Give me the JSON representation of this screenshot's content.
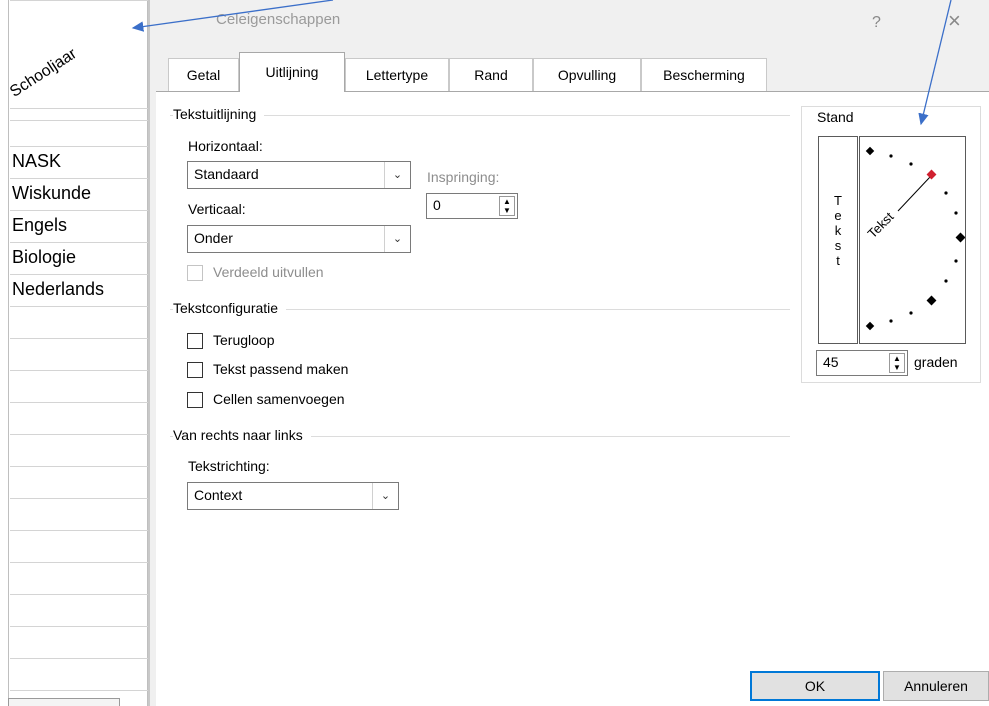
{
  "sheet": {
    "header": "Schooljaar",
    "rows": [
      "NASK",
      "Wiskunde",
      "Engels",
      "Biologie",
      "Nederlands"
    ]
  },
  "dialog": {
    "title": "Celeigenschappen",
    "help": "?",
    "close": "×",
    "tabs": [
      "Getal",
      "Uitlijning",
      "Lettertype",
      "Rand",
      "Opvulling",
      "Bescherming"
    ],
    "active_tab": "Uitlijning",
    "text_alignment": {
      "group": "Tekstuitlijning",
      "horizontal_label": "Horizontaal:",
      "horizontal_value": "Standaard",
      "vertical_label": "Verticaal:",
      "vertical_value": "Onder",
      "indent_label": "Inspringing:",
      "indent_value": "0",
      "distributed_label": "Verdeeld uitvullen"
    },
    "text_control": {
      "group": "Tekstconfiguratie",
      "wrap": "Terugloop",
      "shrink": "Tekst passend maken",
      "merge": "Cellen samenvoegen"
    },
    "rtl": {
      "group": "Van rechts naar links",
      "direction_label": "Tekstrichting:",
      "direction_value": "Context"
    },
    "orientation": {
      "group": "Stand",
      "vertical_letters": [
        "T",
        "e",
        "k",
        "s",
        "t"
      ],
      "dial_text": "Tekst",
      "degrees_value": "45",
      "degrees_label": "graden"
    },
    "ok": "OK",
    "cancel": "Annuleren"
  },
  "colors": {
    "accent": "#0078d7",
    "annotation_arrow": "#3b6fc9",
    "dial_marker": "#d02030"
  }
}
